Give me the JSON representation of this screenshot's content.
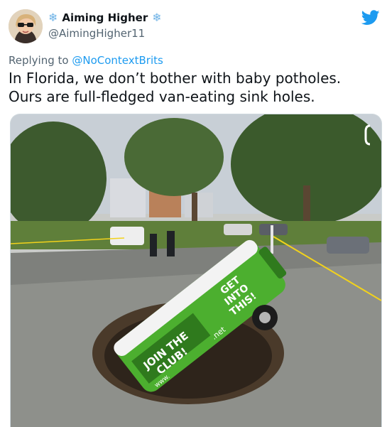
{
  "tweet": {
    "display_name": "Aiming Higher",
    "handle": "@AimingHigher11",
    "reply_prefix": "Replying to",
    "reply_to": "@NoContextBrits",
    "text": "In Florida, we don’t bother with baby potholes. Ours are full-fledged van-eating sink holes."
  },
  "photo": {
    "van_text_1": "JOIN THE",
    "van_text_2": "CLUB!",
    "van_text_3": "GET",
    "van_text_4": "INTO",
    "van_text_5": "THIS!",
    "van_text_6": ".net",
    "van_text_7": "www."
  },
  "colors": {
    "accent": "#1d9bf0",
    "snowflake": "#6fb3e6",
    "van_green": "#4caf2f"
  },
  "icons": [
    "avatar",
    "snowflake-icon",
    "twitter-bird-icon"
  ]
}
